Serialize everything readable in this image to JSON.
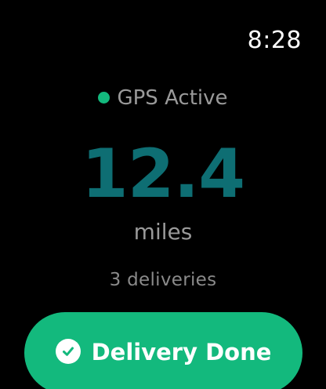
{
  "status": {
    "time": "8:28"
  },
  "gps": {
    "label": "GPS Active",
    "color": "#13b97d"
  },
  "trip": {
    "distance": "12.4",
    "unit": "miles",
    "deliveries": "3 deliveries"
  },
  "action": {
    "label": "Delivery Done",
    "icon": "checkmark-circle-icon",
    "color": "#13b97d"
  },
  "colors": {
    "background": "#000000",
    "distance": "#0e6e73",
    "secondary_text": "#9a9a9a"
  }
}
